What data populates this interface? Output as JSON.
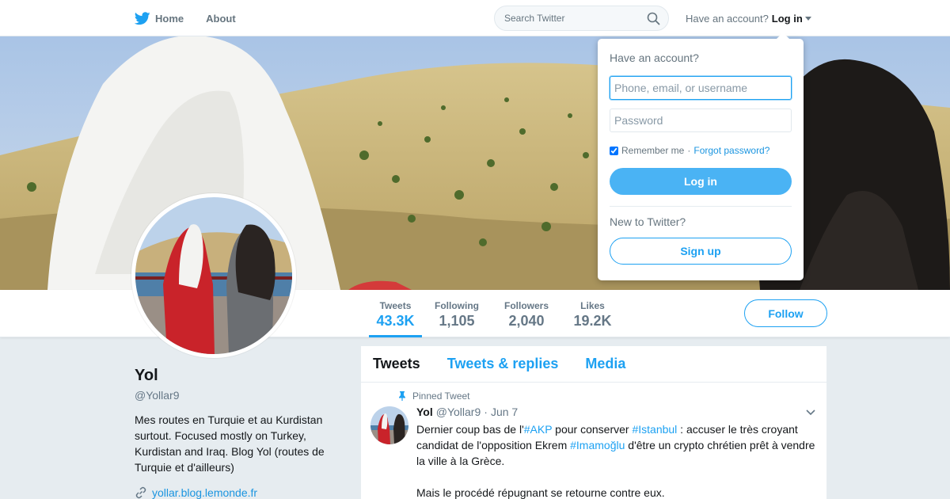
{
  "nav": {
    "home_label": "Home",
    "about_label": "About",
    "search_placeholder": "Search Twitter",
    "have_account_text": "Have an account?",
    "login_label": "Log in"
  },
  "stats": [
    {
      "label": "Tweets",
      "value": "43.3K"
    },
    {
      "label": "Following",
      "value": "1,105"
    },
    {
      "label": "Followers",
      "value": "2,040"
    },
    {
      "label": "Likes",
      "value": "19.2K"
    }
  ],
  "follow_label": "Follow",
  "profile": {
    "name": "Yol",
    "handle": "@Yollar9",
    "bio": "Mes routes en Turquie et au Kurdistan surtout. Focused mostly on Turkey, Kurdistan and Iraq. Blog Yol (routes de Turquie et d'ailleurs)",
    "link": "yollar.blog.lemonde.fr"
  },
  "timeline": {
    "tabs": [
      "Tweets",
      "Tweets & replies",
      "Media"
    ],
    "pinned_label": "Pinned Tweet",
    "tweet": {
      "name": "Yol",
      "handle": "@Yollar9",
      "separator": "·",
      "date": "Jun 7",
      "t1": "Dernier coup bas de l'",
      "h1": "#AKP",
      "t2": " pour conserver ",
      "h2": "#Istanbul",
      "t3": " : accuser le très croyant candidat de l'opposition Ekrem ",
      "h3": "#Imamoğlu",
      "t4": " d'être un crypto chrétien prêt à vendre la ville à la Grèce.",
      "p2": "Mais le procédé répugnant se retourne contre eux."
    }
  },
  "login_dropdown": {
    "title": "Have an account?",
    "username_placeholder": "Phone, email, or username",
    "password_placeholder": "Password",
    "remember_label": "Remember me",
    "separator": "·",
    "forgot_label": "Forgot password?",
    "login_button": "Log in",
    "new_label": "New to Twitter?",
    "signup_button": "Sign up"
  },
  "colors": {
    "brand_blue": "#1da1f2",
    "login_button_bg": "#4ab3f4"
  }
}
